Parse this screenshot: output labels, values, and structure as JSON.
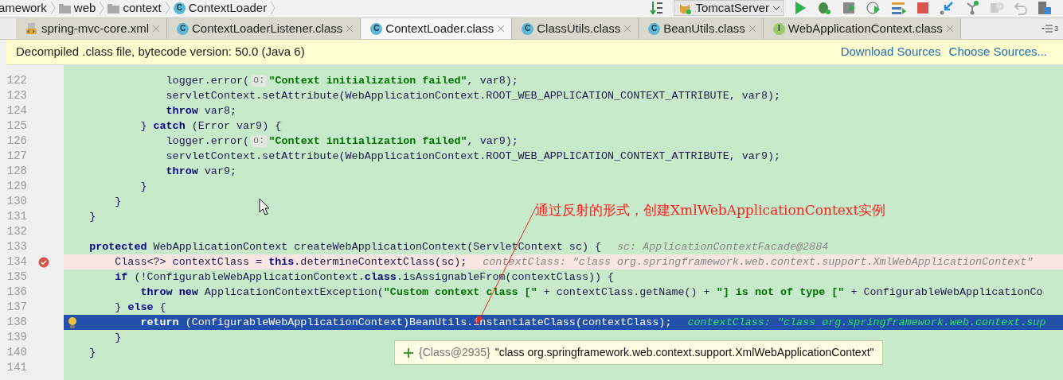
{
  "breadcrumbs": [
    {
      "kind": "folder-cut",
      "label": "amework"
    },
    {
      "kind": "folder",
      "label": "web"
    },
    {
      "kind": "folder",
      "label": "context"
    },
    {
      "kind": "class",
      "badge": "C",
      "label": "ContextLoader"
    }
  ],
  "run_config": {
    "label": "TomcatServer"
  },
  "tabs": [
    {
      "kind": "xml",
      "label": "spring-mvc-core.xml",
      "selected": false
    },
    {
      "kind": "class",
      "badge": "C",
      "label": "ContextLoaderListener.class",
      "selected": false
    },
    {
      "kind": "class",
      "badge": "C",
      "label": "ContextLoader.class",
      "selected": true
    },
    {
      "kind": "class",
      "badge": "C",
      "label": "ClassUtils.class",
      "selected": false
    },
    {
      "kind": "class",
      "badge": "C",
      "label": "BeanUtils.class",
      "selected": false
    },
    {
      "kind": "interface",
      "badge": "I",
      "label": "WebApplicationContext.class",
      "selected": false
    }
  ],
  "tab_overflow": {
    "count": "3"
  },
  "banner": {
    "text": "Decompiled .class file, bytecode version: 50.0 (Java 6)",
    "links": [
      "Download Sources",
      "Choose Sources..."
    ]
  },
  "lines": [
    {
      "number": "122",
      "kind": "normal",
      "segments": [
        {
          "kind": "plain",
          "text": "                logger.error("
        },
        {
          "kind": "param",
          "text": "o:"
        },
        {
          "kind": "string",
          "text": "\"Context initialization failed\""
        },
        {
          "kind": "plain",
          "text": ", var8);"
        }
      ]
    },
    {
      "number": "123",
      "kind": "normal",
      "segments": [
        {
          "kind": "plain",
          "text": "                servletContext.setAttribute(WebApplicationContext.ROOT_WEB_APPLICATION_CONTEXT_ATTRIBUTE, var8);"
        }
      ]
    },
    {
      "number": "124",
      "kind": "normal",
      "segments": [
        {
          "kind": "keyword",
          "text": "                throw"
        },
        {
          "kind": "plain",
          "text": " var8;"
        }
      ]
    },
    {
      "number": "125",
      "kind": "normal",
      "segments": [
        {
          "kind": "plain",
          "text": "            } "
        },
        {
          "kind": "keyword",
          "text": "catch"
        },
        {
          "kind": "plain",
          "text": " (Error var9) {"
        }
      ]
    },
    {
      "number": "126",
      "kind": "normal",
      "segments": [
        {
          "kind": "plain",
          "text": "                logger.error("
        },
        {
          "kind": "param",
          "text": "o:"
        },
        {
          "kind": "string",
          "text": "\"Context initialization failed\""
        },
        {
          "kind": "plain",
          "text": ", var9);"
        }
      ]
    },
    {
      "number": "127",
      "kind": "normal",
      "segments": [
        {
          "kind": "plain",
          "text": "                servletContext.setAttribute(WebApplicationContext.ROOT_WEB_APPLICATION_CONTEXT_ATTRIBUTE, var9);"
        }
      ]
    },
    {
      "number": "128",
      "kind": "normal",
      "segments": [
        {
          "kind": "keyword",
          "text": "                throw"
        },
        {
          "kind": "plain",
          "text": " var9;"
        }
      ]
    },
    {
      "number": "129",
      "kind": "normal",
      "segments": [
        {
          "kind": "plain",
          "text": "            }"
        }
      ]
    },
    {
      "number": "130",
      "kind": "normal",
      "segments": [
        {
          "kind": "plain",
          "text": "        }"
        }
      ]
    },
    {
      "number": "131",
      "kind": "normal",
      "segments": [
        {
          "kind": "plain",
          "text": "    }"
        }
      ]
    },
    {
      "number": "132",
      "kind": "normal"
    },
    {
      "number": "133",
      "kind": "normal",
      "segments": [
        {
          "kind": "keyword",
          "text": "    protected"
        },
        {
          "kind": "plain",
          "text": " WebApplicationContext createWebApplicationContext(ServletContext sc) {"
        },
        {
          "kind": "hint",
          "text": "sc: ApplicationContextFacade@2884"
        }
      ]
    },
    {
      "number": "134",
      "kind": "breakpoint",
      "segments": [
        {
          "kind": "plain",
          "text": "        Class<?> contextClass = "
        },
        {
          "kind": "keyword",
          "text": "this"
        },
        {
          "kind": "plain",
          "text": ".determineContextClass(sc);"
        },
        {
          "kind": "hint",
          "text": "contextClass: \"class org.springframework.web.context.support.XmlWebApplicationContext\""
        }
      ]
    },
    {
      "number": "135",
      "kind": "normal",
      "segments": [
        {
          "kind": "keyword",
          "text": "        if"
        },
        {
          "kind": "plain",
          "text": " (!ConfigurableWebApplicationContext."
        },
        {
          "kind": "keyword",
          "text": "class"
        },
        {
          "kind": "plain",
          "text": ".isAssignableFrom(contextClass)) {"
        }
      ]
    },
    {
      "number": "136",
      "kind": "normal",
      "segments": [
        {
          "kind": "keyword",
          "text": "            throw new"
        },
        {
          "kind": "plain",
          "text": " ApplicationContextException("
        },
        {
          "kind": "string",
          "text": "\"Custom context class [\""
        },
        {
          "kind": "plain",
          "text": " + contextClass.getName() + "
        },
        {
          "kind": "string",
          "text": "\"] is not of type [\""
        },
        {
          "kind": "plain",
          "text": " + ConfigurableWebApplicationCo"
        }
      ]
    },
    {
      "number": "137",
      "kind": "normal",
      "segments": [
        {
          "kind": "plain",
          "text": "        } "
        },
        {
          "kind": "keyword",
          "text": "else"
        },
        {
          "kind": "plain",
          "text": " {"
        }
      ]
    },
    {
      "number": "138",
      "kind": "current",
      "segments": [
        {
          "kind": "keyword",
          "text": "            return"
        },
        {
          "kind": "plain",
          "text": " (ConfigurableWebApplicationContext)BeanUtils.instantiateClass(contextClass);"
        },
        {
          "kind": "hint",
          "text": "contextClass: \"class org.springframework.web.context.sup"
        }
      ]
    },
    {
      "number": "139",
      "kind": "normal",
      "segments": [
        {
          "kind": "plain",
          "text": "        }"
        }
      ]
    },
    {
      "number": "140",
      "kind": "normal",
      "segments": [
        {
          "kind": "plain",
          "text": "    }"
        }
      ]
    },
    {
      "number": "141",
      "kind": "normal"
    }
  ],
  "annotation": {
    "text": "通过反射的形式，创建XmlWebApplicationContext实例"
  },
  "tooltip": {
    "type": "{Class@2935}",
    "value": "\"class org.springframework.web.context.support.XmlWebApplicationContext\""
  }
}
